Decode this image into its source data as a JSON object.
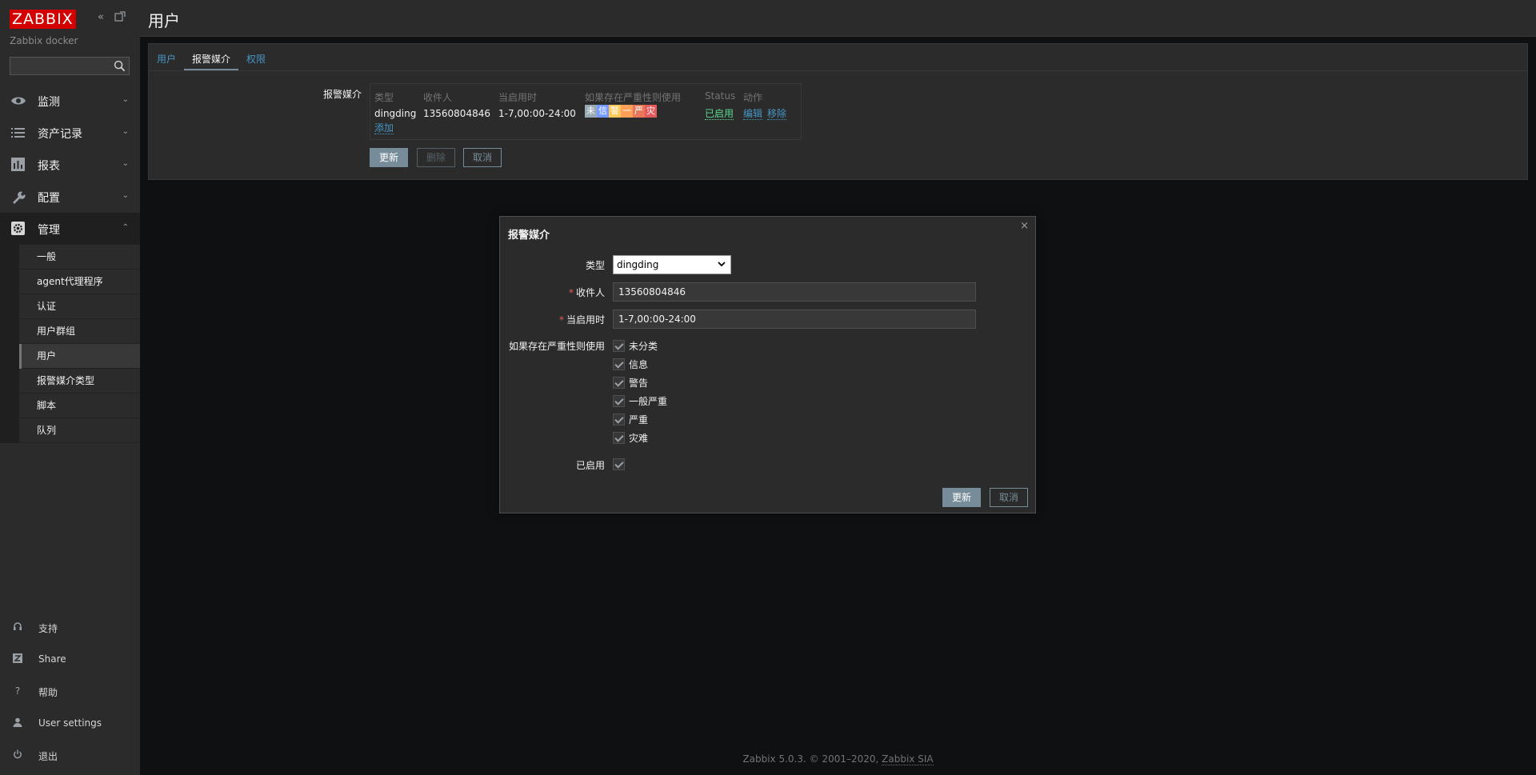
{
  "sidebar": {
    "logo": "ZABBIX",
    "server_name": "Zabbix docker",
    "search": {
      "value": "",
      "placeholder": ""
    },
    "nav": [
      {
        "label": "监测",
        "icon": "eye-icon"
      },
      {
        "label": "资产记录",
        "icon": "list-icon"
      },
      {
        "label": "报表",
        "icon": "chart-icon"
      },
      {
        "label": "配置",
        "icon": "wrench-icon"
      },
      {
        "label": "管理",
        "icon": "gear-icon"
      }
    ],
    "admin_sub": [
      {
        "label": "一般"
      },
      {
        "label": "agent代理程序"
      },
      {
        "label": "认证"
      },
      {
        "label": "用户群组"
      },
      {
        "label": "用户"
      },
      {
        "label": "报警媒介类型"
      },
      {
        "label": "脚本"
      },
      {
        "label": "队列"
      }
    ],
    "bottom": [
      {
        "label": "支持",
        "icon": "headset-icon"
      },
      {
        "label": "Share",
        "icon": "share-icon"
      },
      {
        "label": "帮助",
        "icon": "help-icon"
      },
      {
        "label": "User settings",
        "icon": "user-icon"
      },
      {
        "label": "退出",
        "icon": "power-icon"
      }
    ]
  },
  "header": {
    "title": "用户"
  },
  "tabs": [
    {
      "label": "用户"
    },
    {
      "label": "报警媒介"
    },
    {
      "label": "权限"
    }
  ],
  "media": {
    "form_label": "报警媒介",
    "columns": [
      "类型",
      "收件人",
      "当启用时",
      "如果存在严重性则使用",
      "Status",
      "动作"
    ],
    "rows": [
      {
        "type": "dingding",
        "recipient": "13560804846",
        "when_active": "1-7,00:00-24:00",
        "severity_badges": [
          "未",
          "信",
          "警",
          "一",
          "严",
          "灾"
        ],
        "status": "已启用",
        "action_edit": "编辑",
        "action_remove": "移除"
      }
    ],
    "add_link": "添加"
  },
  "form_buttons": {
    "update": "更新",
    "delete": "删除",
    "cancel": "取消"
  },
  "dialog": {
    "title": "报警媒介",
    "type_label": "类型",
    "type_value": "dingding",
    "send_to_label": "收件人",
    "send_to_value": "13560804846",
    "when_active_label": "当启用时",
    "when_active_value": "1-7,00:00-24:00",
    "severity_label": "如果存在严重性则使用",
    "severities": [
      "未分类",
      "信息",
      "警告",
      "一般严重",
      "严重",
      "灾难"
    ],
    "enabled_label": "已启用",
    "update_button": "更新",
    "cancel_button": "取消"
  },
  "footer": {
    "text": "Zabbix 5.0.3. © 2001–2020, ",
    "link": "Zabbix SIA"
  },
  "colors": {
    "logo": "#d40000",
    "link": "#4796c4",
    "button": "#768d99",
    "status_enabled": "#59db8f",
    "severity": [
      "#97aab3",
      "#7499ff",
      "#ffc859",
      "#ffa059",
      "#e97659",
      "#e45959"
    ]
  }
}
